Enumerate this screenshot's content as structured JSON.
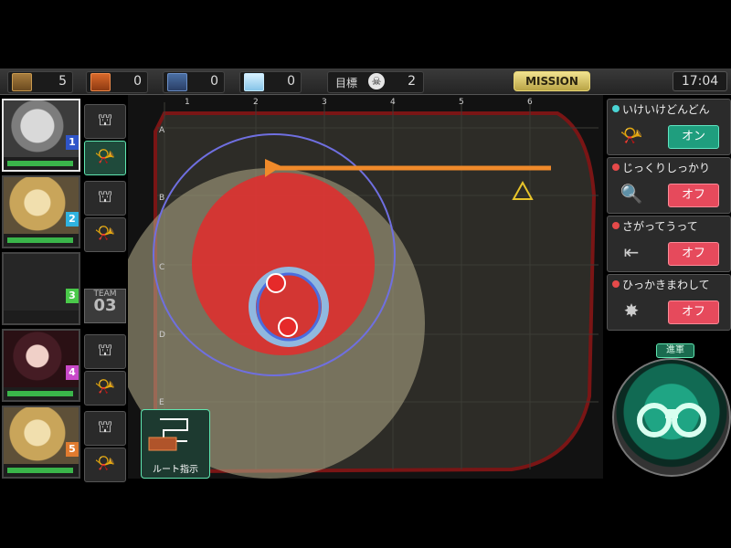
{
  "resources": [
    {
      "name": "wood-crate",
      "count": "5"
    },
    {
      "name": "orange-crate",
      "count": "0"
    },
    {
      "name": "blue-crate",
      "count": "0"
    },
    {
      "name": "ice-crate",
      "count": "0"
    }
  ],
  "goal": {
    "label": "目標",
    "count": "2"
  },
  "mission_label": "MISSION",
  "clock": "17:04",
  "units": [
    {
      "num": "1",
      "color": "#2f55c9",
      "hp": 1.0
    },
    {
      "num": "2",
      "color": "#2fb3e0",
      "hp": 1.0
    },
    {
      "num": "3",
      "color": "#4ac94a",
      "hp": 0
    },
    {
      "num": "4",
      "color": "#c94ac9",
      "hp": 1.0
    },
    {
      "num": "5",
      "color": "#e07b2f",
      "hp": 1.0
    }
  ],
  "team_badge": {
    "label": "TEAM",
    "number": "03"
  },
  "map": {
    "col_labels": [
      "1",
      "2",
      "3",
      "4",
      "5",
      "6"
    ],
    "row_labels": [
      "A",
      "B",
      "C",
      "D",
      "E"
    ]
  },
  "options": [
    {
      "title": "いけいけどんどん",
      "state": "オン",
      "on": true,
      "lamp": "#4ad4d4",
      "icon": "trumpet-icon"
    },
    {
      "title": "じっくりしっかり",
      "state": "オフ",
      "on": false,
      "lamp": "#e64a4a",
      "icon": "magnifier-icon"
    },
    {
      "title": "さがってうって",
      "state": "オフ",
      "on": false,
      "lamp": "#e64a4a",
      "icon": "retreat-icon"
    },
    {
      "title": "ひっかきまわして",
      "state": "オフ",
      "on": false,
      "lamp": "#e64a4a",
      "icon": "scatter-icon"
    }
  ],
  "advance_label": "進軍",
  "route_label": "ルート指示",
  "colors": {
    "accent_green": "#5fe6b0",
    "on_green": "#1f9e7e",
    "off_red": "#e64a5c",
    "danger_red": "#e83a3a",
    "path_orange": "#f08a2a"
  }
}
